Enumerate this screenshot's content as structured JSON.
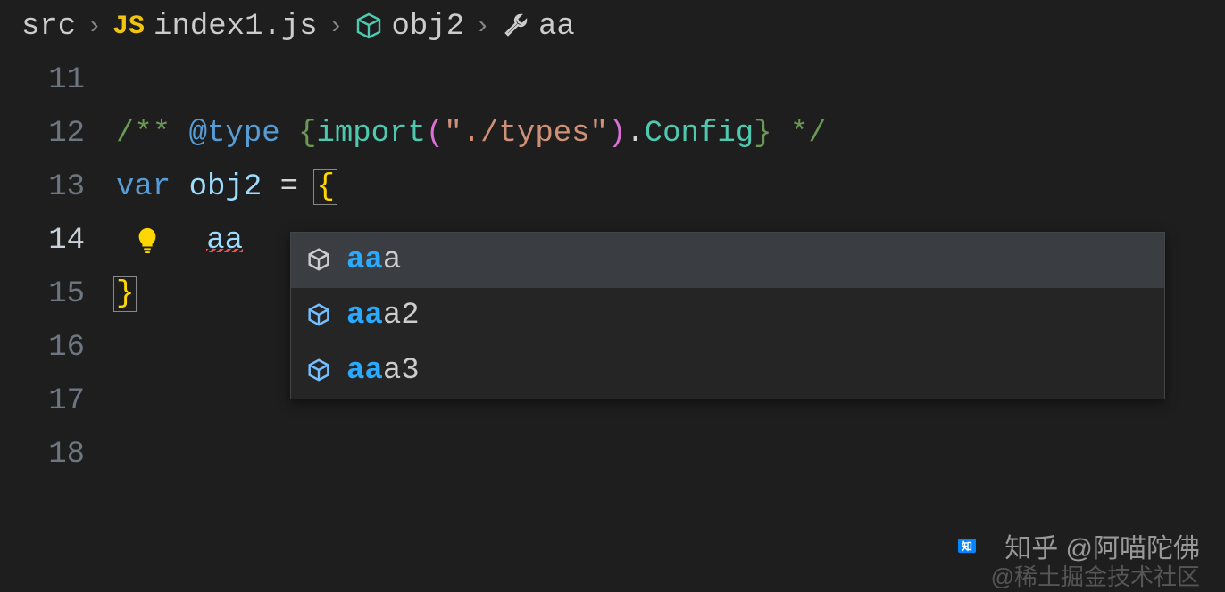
{
  "breadcrumb": {
    "folder": "src",
    "file": "index1.js",
    "object": "obj2",
    "method": "aa"
  },
  "lines": {
    "11": "11",
    "12": "12",
    "13": "13",
    "14": "14",
    "15": "15",
    "16": "16",
    "17": "17",
    "18": "18"
  },
  "code": {
    "comment_open": "/** ",
    "jsdoc_tag": "@type",
    "type_open": " {",
    "import_fn": "import",
    "paren_open": "(",
    "import_path": "\"./types\"",
    "paren_close": ")",
    "dot": ".",
    "type_name": "Config",
    "type_close": "} ",
    "comment_close": "*/",
    "var_keyword": "var ",
    "var_name": "obj2",
    "assign": " = ",
    "open_brace": "{",
    "typed_text": "aa",
    "close_brace": "}"
  },
  "autocomplete": {
    "items": [
      {
        "match": "aa",
        "rest": "a",
        "selected": true
      },
      {
        "match": "aa",
        "rest": "a2",
        "selected": false
      },
      {
        "match": "aa",
        "rest": "a3",
        "selected": false
      }
    ]
  },
  "watermark": {
    "main": "知乎 @阿喵陀佛",
    "sub": "@稀土掘金技术社区"
  }
}
